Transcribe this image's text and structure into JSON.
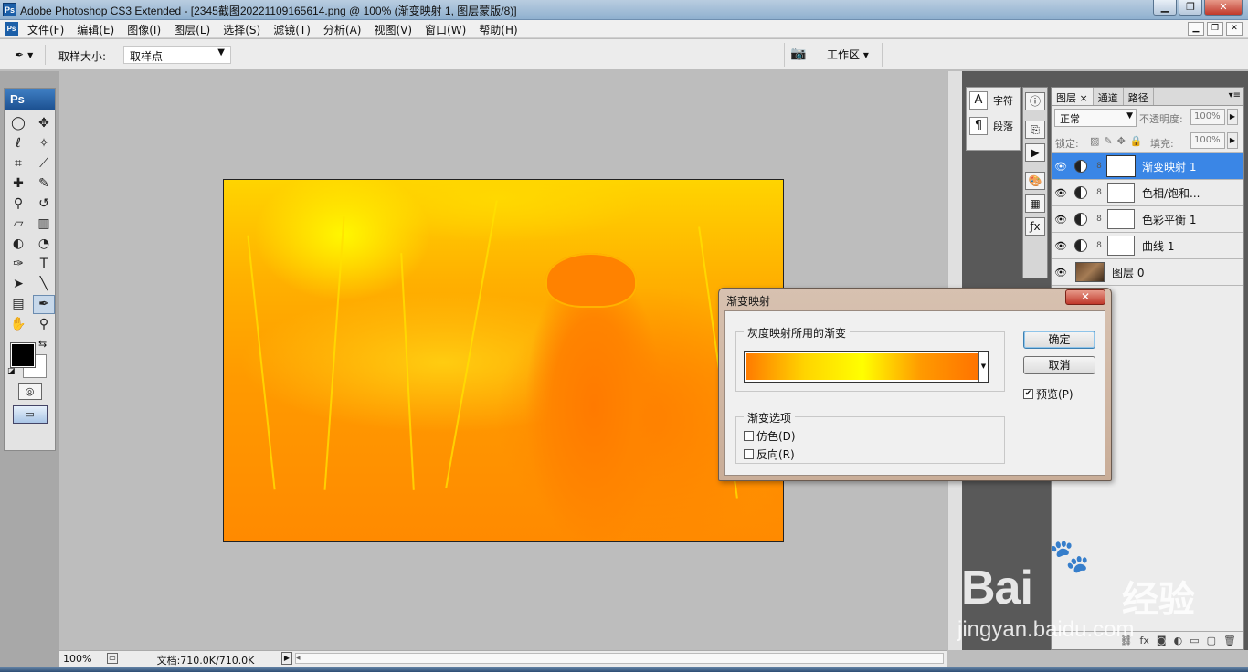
{
  "window": {
    "title": "Adobe Photoshop CS3 Extended - [2345截图20221109165614.png @ 100% (渐变映射 1, 图层蒙版/8)]",
    "app_icon": "Ps",
    "controls": [
      "▁",
      "❐",
      "✕"
    ]
  },
  "menubar": {
    "items": [
      "文件(F)",
      "编辑(E)",
      "图像(I)",
      "图层(L)",
      "选择(S)",
      "滤镜(T)",
      "分析(A)",
      "视图(V)",
      "窗口(W)",
      "帮助(H)"
    ],
    "doc_controls": [
      "▁",
      "❐",
      "✕"
    ]
  },
  "options": {
    "sample_size_label": "取样大小:",
    "sample_size_value": "取样点",
    "workspace_label": "工作区 ▾"
  },
  "toolbox": {
    "badge": "Ps",
    "tools": [
      "marquee-icon",
      "move-icon",
      "lasso-icon",
      "magic-wand-icon",
      "crop-icon",
      "slice-icon",
      "healing-icon",
      "brush-icon",
      "stamp-icon",
      "history-brush-icon",
      "eraser-icon",
      "gradient-icon",
      "blur-icon",
      "dodge-icon",
      "pen-icon",
      "type-icon",
      "path-select-icon",
      "line-icon",
      "notes-icon",
      "eyedropper-icon",
      "hand-icon",
      "zoom-icon"
    ],
    "foreground_color": "#000000",
    "background_color": "#ffffff"
  },
  "status": {
    "zoom": "100%",
    "doc_info": "文档:710.0K/710.0K"
  },
  "side_panel": {
    "character_label": "字符",
    "paragraph_label": "段落"
  },
  "layers_panel": {
    "tabs": [
      "图层",
      "通道",
      "路径"
    ],
    "tab_close": "×",
    "blend_mode": "正常",
    "opacity_label": "不透明度:",
    "opacity_value": "100%",
    "lock_label": "锁定:",
    "fill_label": "填充:",
    "fill_value": "100%",
    "layers": [
      {
        "name": "渐变映射 1",
        "type": "adjustment",
        "selected": true
      },
      {
        "name": "色相/饱和...",
        "type": "adjustment",
        "selected": false
      },
      {
        "name": "色彩平衡 1",
        "type": "adjustment",
        "selected": false
      },
      {
        "name": "曲线 1",
        "type": "adjustment",
        "selected": false
      },
      {
        "name": "图层 0",
        "type": "pixel",
        "selected": false
      }
    ]
  },
  "dialog": {
    "title": "渐变映射",
    "close": "✕",
    "gradient_group_label": "灰度映射所用的渐变",
    "gradient_colors": [
      "#ff7b00",
      "#ffd400",
      "#ffff00",
      "#ff9a00",
      "#ff7300"
    ],
    "options_group_label": "渐变选项",
    "dither_label": "仿色(D)",
    "dither_checked": false,
    "reverse_label": "反向(R)",
    "reverse_checked": false,
    "ok_label": "确定",
    "cancel_label": "取消",
    "preview_label": "预览(P)",
    "preview_checked": true
  },
  "watermark": {
    "brand": "Bai",
    "brand_cn": "经验",
    "url": "jingyan.baidu.com"
  }
}
